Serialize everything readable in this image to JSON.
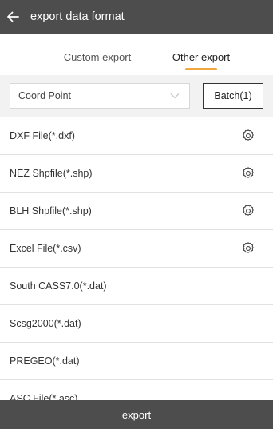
{
  "header": {
    "title": "export data format"
  },
  "tabs": [
    {
      "label": "Custom export"
    },
    {
      "label": "Other export"
    }
  ],
  "filter": {
    "select_value": "Coord Point",
    "batch_label": "Batch(1)"
  },
  "items": [
    {
      "label": "DXF File(*.dxf)",
      "has_settings": true
    },
    {
      "label": "NEZ Shpfile(*.shp)",
      "has_settings": true
    },
    {
      "label": "BLH Shpfile(*.shp)",
      "has_settings": true
    },
    {
      "label": "Excel File(*.csv)",
      "has_settings": true
    },
    {
      "label": "South CASS7.0(*.dat)",
      "has_settings": false
    },
    {
      "label": "Scsg2000(*.dat)",
      "has_settings": false
    },
    {
      "label": "PREGEO(*.dat)",
      "has_settings": false
    },
    {
      "label": "ASC File(*.asc)",
      "has_settings": false
    }
  ],
  "footer": {
    "export_label": "export"
  },
  "colors": {
    "header_bg": "#4d4d4d",
    "accent": "#f2a640"
  }
}
